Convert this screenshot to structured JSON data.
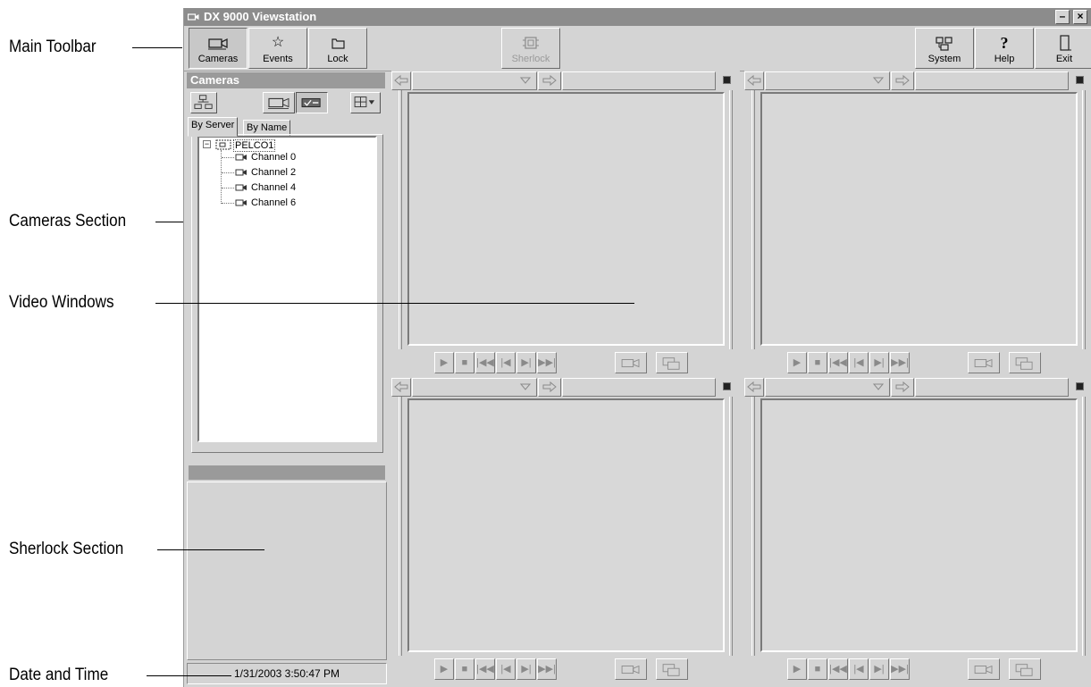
{
  "callouts": {
    "main_toolbar": "Main Toolbar",
    "cameras_section": "Cameras Section",
    "video_windows": "Video Windows",
    "sherlock_section": "Sherlock Section",
    "date_time": "Date and Time"
  },
  "window": {
    "title": "DX 9000 Viewstation",
    "minimize": "–",
    "close": "×"
  },
  "toolbar": {
    "cameras": "Cameras",
    "events": "Events",
    "lock": "Lock",
    "sherlock": "Sherlock",
    "system": "System",
    "help": "Help",
    "exit": "Exit"
  },
  "cameras_panel": {
    "title": "Cameras",
    "tabs": [
      "By Server",
      "By Name"
    ],
    "server": "PELCO1",
    "channels": [
      "Channel 0",
      "Channel 2",
      "Channel 4",
      "Channel 6"
    ]
  },
  "status": {
    "datetime": "1/31/2003 3:50:47 PM"
  },
  "icons": {
    "back": "arrow-left-icon",
    "forward": "arrow-right-icon",
    "dropdown": "chevron-down-icon",
    "play": "play-icon",
    "stop": "stop-icon",
    "first": "skip-back-icon",
    "step_back": "step-back-icon",
    "step_forward": "step-forward-icon",
    "last": "skip-forward-icon"
  },
  "colors": {
    "face": "#d4d4d4",
    "title": "#8c8c8c",
    "header": "#9a9a9a"
  }
}
